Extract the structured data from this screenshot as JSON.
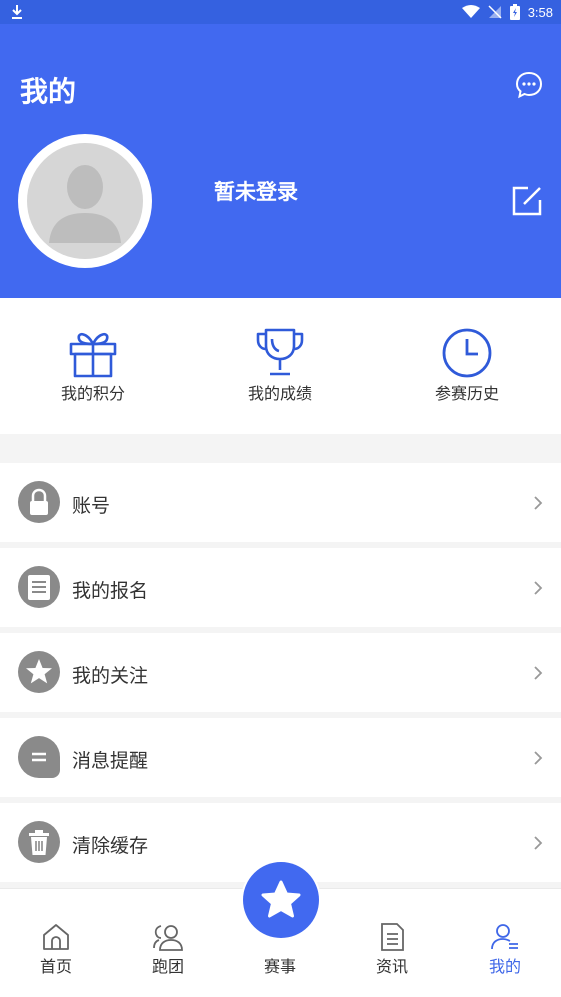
{
  "status_bar": {
    "time": "3:58"
  },
  "header": {
    "title": "我的",
    "login_text": "暂未登录"
  },
  "quick_actions": [
    {
      "label": "我的积分",
      "icon": "gift-icon"
    },
    {
      "label": "我的成绩",
      "icon": "trophy-icon"
    },
    {
      "label": "参赛历史",
      "icon": "clock-icon"
    }
  ],
  "menu": [
    {
      "label": "账号",
      "icon": "lock-icon"
    },
    {
      "label": "我的报名",
      "icon": "document-icon"
    },
    {
      "label": "我的关注",
      "icon": "star-icon"
    },
    {
      "label": "消息提醒",
      "icon": "chat-icon"
    },
    {
      "label": "清除缓存",
      "icon": "trash-icon"
    }
  ],
  "tabbar": [
    {
      "label": "首页",
      "icon": "home-icon"
    },
    {
      "label": "跑团",
      "icon": "team-icon"
    },
    {
      "label": "赛事",
      "icon": "star-icon"
    },
    {
      "label": "资讯",
      "icon": "news-icon"
    },
    {
      "label": "我的",
      "icon": "profile-icon",
      "active": true
    }
  ],
  "colors": {
    "brand": "#4169f0",
    "active_tab": "#3f67e8",
    "menu_icon_bg": "#8a8a8a"
  }
}
